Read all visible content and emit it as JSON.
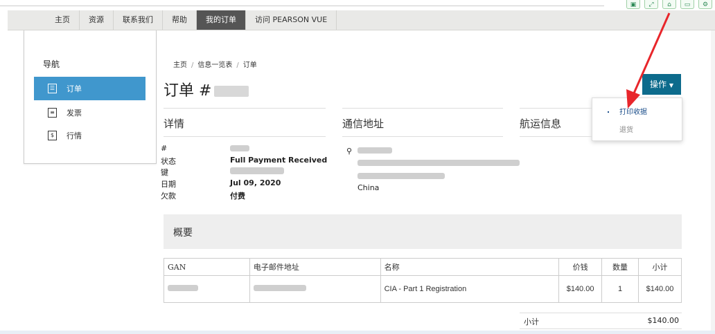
{
  "nav": {
    "items": [
      {
        "label": "主页",
        "active": false
      },
      {
        "label": "资源",
        "active": false
      },
      {
        "label": "联系我们",
        "active": false
      },
      {
        "label": "帮助",
        "active": false
      },
      {
        "label": "我的订单",
        "active": true
      },
      {
        "label": "访问 PEARSON VUE",
        "active": false
      }
    ]
  },
  "sidebar": {
    "title": "导航",
    "items": [
      {
        "label": "订单",
        "icon": "order-icon",
        "active": true
      },
      {
        "label": "发票",
        "icon": "invoice-icon",
        "active": false
      },
      {
        "label": "行情",
        "icon": "quote-icon",
        "active": false
      }
    ]
  },
  "breadcrumb": {
    "home": "主页",
    "list": "信息一览表",
    "current": "订单"
  },
  "page": {
    "title_prefix": "订单 #"
  },
  "actions": {
    "button_label": "操作",
    "menu": [
      {
        "label": "打印收据"
      },
      {
        "label": "退货"
      }
    ]
  },
  "sections": {
    "details": "详情",
    "mailing": "通信地址",
    "shipping": "航运信息",
    "summary": "概要"
  },
  "details": {
    "labels": {
      "number": "#",
      "status": "状态",
      "key": "键",
      "date": "日期",
      "balance": "欠款"
    },
    "values": {
      "status": "Full Payment Received",
      "date": "Jul 09, 2020",
      "balance": "付费"
    }
  },
  "address": {
    "country": "China"
  },
  "table": {
    "headers": [
      "GAN",
      "电子邮件地址",
      "名称",
      "价钱",
      "数量",
      "小计"
    ],
    "rows": [
      {
        "name": "CIA - Part 1 Registration",
        "price": "$140.00",
        "qty": "1",
        "subtotal": "$140.00"
      }
    ]
  },
  "totals": {
    "subtotal_label": "小计",
    "subtotal_value": "$140.00"
  },
  "colors": {
    "accent": "#4097cd",
    "button": "#0d6b8c",
    "arrow": "#e8262b",
    "nav_active": "#555555"
  }
}
